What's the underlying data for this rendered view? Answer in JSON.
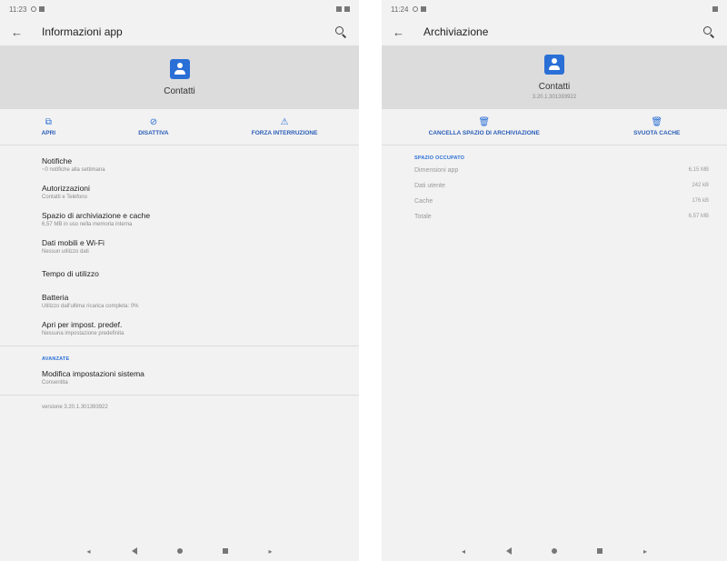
{
  "left": {
    "status_time": "11:23",
    "title": "Informazioni app",
    "app_name": "Contatti",
    "actions": [
      {
        "label": "APRI",
        "icon": "open-icon"
      },
      {
        "label": "DISATTIVA",
        "icon": "disable-icon"
      },
      {
        "label": "FORZA INTERRUZIONE",
        "icon": "warning-icon"
      }
    ],
    "items": [
      {
        "title": "Notifiche",
        "subtitle": "~0 notifiche alla settimana"
      },
      {
        "title": "Autorizzazioni",
        "subtitle": "Contatti e Telefono"
      },
      {
        "title": "Spazio di archiviazione e cache",
        "subtitle": "6,57 MB in uso nella memoria interna"
      },
      {
        "title": "Dati mobili e Wi-Fi",
        "subtitle": "Nessun utilizzo dati"
      },
      {
        "title": "Tempo di utilizzo",
        "subtitle": ""
      },
      {
        "title": "Batteria",
        "subtitle": "Utilizzo dall'ultima ricarica completa: 0%"
      },
      {
        "title": "Apri per impost. predef.",
        "subtitle": "Nessuna impostazione predefinita"
      }
    ],
    "advanced_label": "AVANZATE",
    "advanced_item": {
      "title": "Modifica impostazioni sistema",
      "subtitle": "Consentita"
    },
    "version": "versione 3.20.1.301393922"
  },
  "right": {
    "status_time": "11:24",
    "title": "Archiviazione",
    "app_name": "Contatti",
    "app_version": "3.20.1.301393922",
    "actions": [
      {
        "label": "CANCELLA SPAZIO DI ARCHIVIAZIONE",
        "icon": "trash-icon"
      },
      {
        "label": "SVUOTA CACHE",
        "icon": "trash-icon"
      }
    ],
    "section_label": "SPAZIO OCCUPATO",
    "rows": [
      {
        "label": "Dimensioni app",
        "value": "6,15 MB"
      },
      {
        "label": "Dati utente",
        "value": "242 kB"
      },
      {
        "label": "Cache",
        "value": "176 kB"
      },
      {
        "label": "Totale",
        "value": "6,57 MB"
      }
    ]
  },
  "colors": {
    "accent": "#2a6fd6",
    "header_bg": "#dcdcdc",
    "screen_bg": "#f2f2f2"
  }
}
